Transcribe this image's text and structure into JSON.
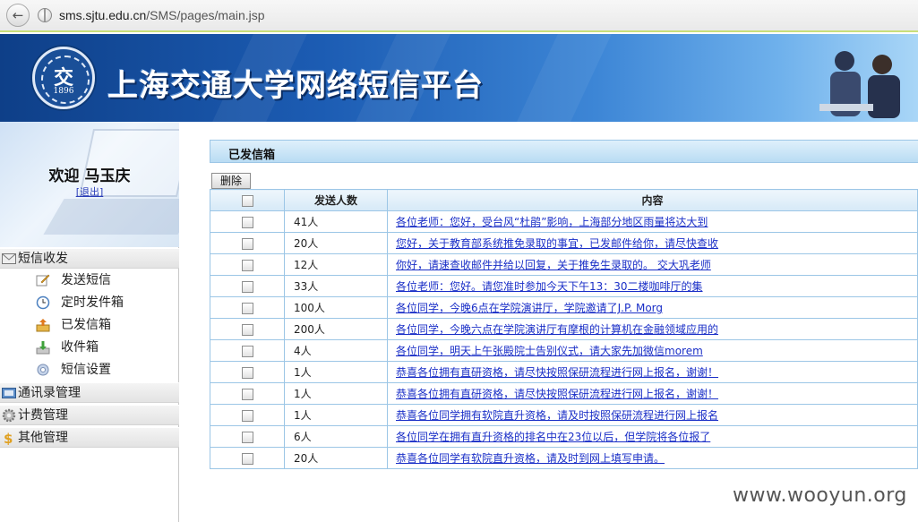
{
  "browser": {
    "url_host": "sms.sjtu.edu.cn",
    "url_path": "/SMS/pages/main.jsp"
  },
  "header": {
    "site_title": "上海交通大学网络短信平台",
    "logo_year": "1896"
  },
  "sidebar": {
    "welcome": "欢迎 马玉庆",
    "logout": "[退出]",
    "groups": [
      {
        "label": "短信收发",
        "icon": "envelope-icon"
      },
      {
        "label": "通讯录管理",
        "icon": "address-book-icon"
      },
      {
        "label": "计费管理",
        "icon": "gear-icon"
      },
      {
        "label": "其他管理",
        "icon": "dollar-icon"
      }
    ],
    "items": [
      {
        "label": "发送短信",
        "icon": "compose-icon"
      },
      {
        "label": "定时发件箱",
        "icon": "clock-icon"
      },
      {
        "label": "已发信箱",
        "icon": "outbox-icon"
      },
      {
        "label": "收件箱",
        "icon": "inbox-icon"
      },
      {
        "label": "短信设置",
        "icon": "settings-icon"
      }
    ]
  },
  "main": {
    "section_title": "已发信箱",
    "delete_button": "删除",
    "columns": [
      "",
      "发送人数",
      "内容"
    ],
    "rows": [
      {
        "count": "41人",
        "content": "各位老师：您好，受台风“杜鹃”影响，上海部分地区雨量将达大到"
      },
      {
        "count": "20人",
        "content": "您好，关于教育部系统推免录取的事宜，已发邮件给你，请尽快查收"
      },
      {
        "count": "12人",
        "content": "你好，请速查收邮件并给以回复，关于推免生录取的。 交大巩老师"
      },
      {
        "count": "33人",
        "content": "各位老师：您好。请您准时参加今天下午13：30二楼咖啡厅的集"
      },
      {
        "count": "100人",
        "content": "各位同学，今晚6点在学院演讲厅，学院邀请了J.P. Morg"
      },
      {
        "count": "200人",
        "content": "各位同学，今晚六点在学院演讲厅有摩根的计算机在金融领域应用的"
      },
      {
        "count": "4人",
        "content": "各位同学，明天上午张殿院士告别仪式，请大家先加微信morem"
      },
      {
        "count": "1人",
        "content": "恭喜各位拥有直研资格，请尽快按照保研流程进行网上报名，谢谢！"
      },
      {
        "count": "1人",
        "content": "恭喜各位拥有直研资格，请尽快按照保研流程进行网上报名，谢谢！"
      },
      {
        "count": "1人",
        "content": "恭喜各位同学拥有软院直升资格，请及时按照保研流程进行网上报名"
      },
      {
        "count": "6人",
        "content": "各位同学在拥有直升资格的排名中在23位以后，但学院将各位报了"
      },
      {
        "count": "20人",
        "content": "恭喜各位同学有软院直升资格，请及时到网上填写申请。"
      }
    ]
  },
  "watermark": "www.wooyun.org"
}
